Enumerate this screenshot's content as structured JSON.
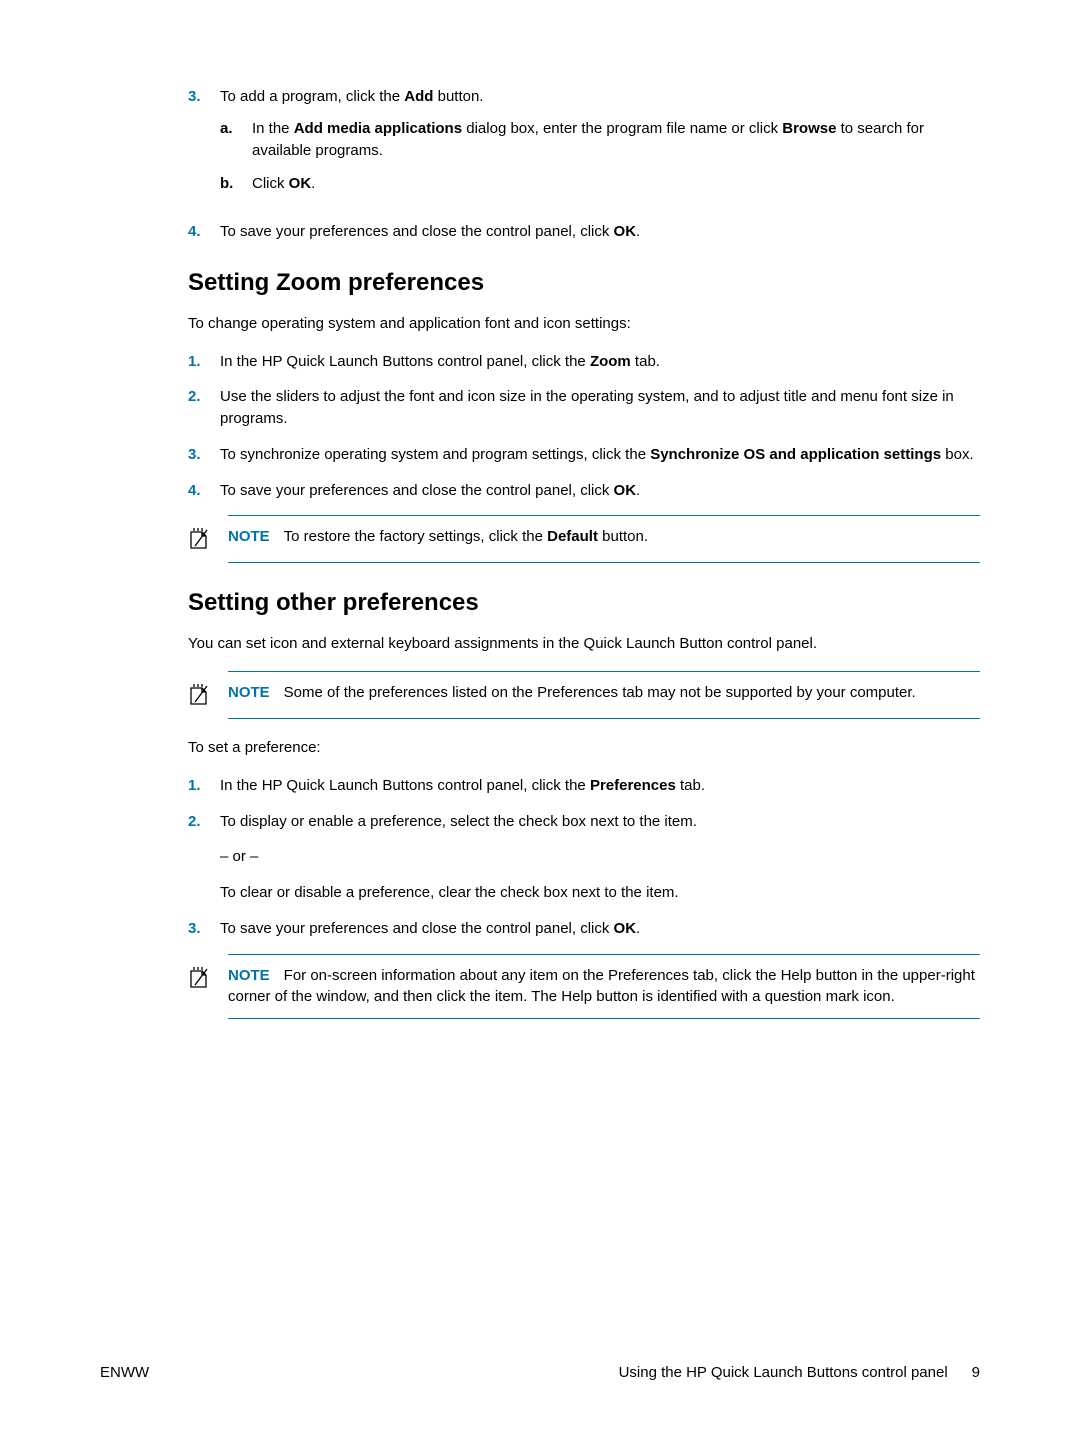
{
  "list1": {
    "item3": {
      "num": "3.",
      "text_pre": "To add a program, click the ",
      "bold1": "Add",
      "text_post": " button.",
      "sub_a": {
        "marker": "a.",
        "pre": "In the ",
        "b1": "Add media applications",
        "mid": " dialog box, enter the program file name or click ",
        "b2": "Browse",
        "post": " to search for available programs."
      },
      "sub_b": {
        "marker": "b.",
        "pre": "Click ",
        "b1": "OK",
        "post": "."
      }
    },
    "item4": {
      "num": "4.",
      "pre": "To save your preferences and close the control panel, click ",
      "b1": "OK",
      "post": "."
    }
  },
  "heading1": "Setting Zoom preferences",
  "para1": "To change operating system and application font and icon settings:",
  "list2": {
    "item1": {
      "num": "1.",
      "pre": "In the HP Quick Launch Buttons control panel, click the ",
      "b1": "Zoom",
      "post": " tab."
    },
    "item2": {
      "num": "2.",
      "text": "Use the sliders to adjust the font and icon size in the operating system, and to adjust title and menu font size in programs."
    },
    "item3": {
      "num": "3.",
      "pre": "To synchronize operating system and program settings, click the ",
      "b1": "Synchronize OS and application settings",
      "post": " box."
    },
    "item4": {
      "num": "4.",
      "pre": "To save your preferences and close the control panel, click ",
      "b1": "OK",
      "post": "."
    }
  },
  "note1": {
    "label": "NOTE",
    "pre": "To restore the factory settings, click the ",
    "b1": "Default",
    "post": " button."
  },
  "heading2": "Setting other preferences",
  "para2": "You can set icon and external keyboard assignments in the Quick Launch Button control panel.",
  "note2": {
    "label": "NOTE",
    "text": "Some of the preferences listed on the Preferences tab may not be supported by your computer."
  },
  "para3": "To set a preference:",
  "list3": {
    "item1": {
      "num": "1.",
      "pre": "In the HP Quick Launch Buttons control panel, click the ",
      "b1": "Preferences",
      "post": " tab."
    },
    "item2": {
      "num": "2.",
      "text": "To display or enable a preference, select the check box next to the item."
    },
    "or": "– or –",
    "clear": "To clear or disable a preference, clear the check box next to the item.",
    "item3": {
      "num": "3.",
      "pre": "To save your preferences and close the control panel, click ",
      "b1": "OK",
      "post": "."
    }
  },
  "note3": {
    "label": "NOTE",
    "text": "For on-screen information about any item on the Preferences tab, click the Help button in the upper-right corner of the window, and then click the item. The Help button is identified with a question mark icon."
  },
  "footer": {
    "left": "ENWW",
    "center": "Using the HP Quick Launch Buttons control panel",
    "pagenum": "9"
  }
}
